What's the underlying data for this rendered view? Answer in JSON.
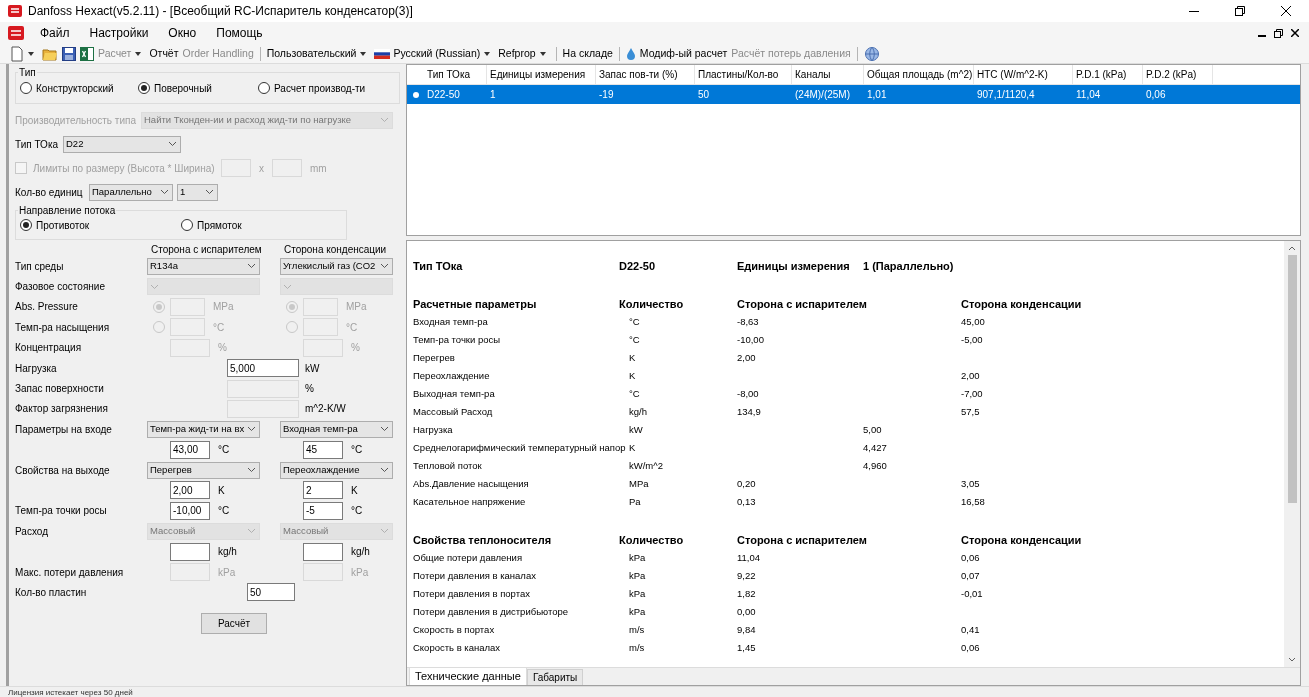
{
  "window": {
    "title": "Danfoss Hexact(v5.2.11) - [Всеобщий RC-Испаритель конденсатор(3)]"
  },
  "menu": [
    "Файл",
    "Настройки",
    "Окно",
    "Помощь"
  ],
  "toolbar": [
    {
      "kind": "icon",
      "dropdown": true
    },
    {
      "kind": "icon",
      "dropdown": false
    },
    {
      "kind": "icon",
      "dropdown": false
    },
    {
      "kind": "icon",
      "dropdown": false
    },
    {
      "kind": "text",
      "label": "Расчет",
      "disabled": true,
      "dropdown": true
    },
    {
      "kind": "text",
      "label": "Отчёт",
      "disabled": false,
      "dropdown": false
    },
    {
      "kind": "text",
      "label": "Order Handling",
      "disabled": true,
      "dropdown": false
    },
    {
      "kind": "separator"
    },
    {
      "kind": "text",
      "label": "Пользовательский",
      "disabled": false,
      "dropdown": true
    },
    {
      "kind": "language",
      "label": "Русский (Russian)",
      "disabled": false,
      "dropdown": true
    },
    {
      "kind": "text",
      "label": "Refprop",
      "disabled": false,
      "dropdown": true
    },
    {
      "kind": "separator"
    },
    {
      "kind": "text",
      "label": "На складе",
      "disabled": false,
      "dropdown": false
    },
    {
      "kind": "separator"
    },
    {
      "kind": "icon",
      "dropdown": false
    },
    {
      "kind": "text",
      "label": "Модиф-ый расчет",
      "disabled": false,
      "dropdown": false
    },
    {
      "kind": "text",
      "label": "Расчёт потерь давления",
      "disabled": true,
      "dropdown": false
    },
    {
      "kind": "separator"
    },
    {
      "kind": "icon",
      "dropdown": false
    }
  ],
  "left": {
    "type_group": {
      "legend": "Тип",
      "options": [
        {
          "label": "Конструкторский",
          "selected": false
        },
        {
          "label": "Поверочный",
          "selected": true
        },
        {
          "label": "Расчет производ-ти",
          "selected": false
        }
      ]
    },
    "performance": {
      "label": "Производительность типа",
      "value": "Найти  Тконден-ии и расход жид-ти по нагрузке",
      "disabled": true
    },
    "hex_type": {
      "label": "Тип ТОка",
      "value": "D22"
    },
    "size_limit": {
      "label": "Лимиты по размеру (Высота * Ширина)",
      "checked": false,
      "separator": "x",
      "unit": "mm"
    },
    "units": {
      "label": "Кол-во единиц",
      "mode": "Параллельно",
      "count": "1"
    },
    "flow": {
      "legend": "Направление потока",
      "options": [
        {
          "label": "Противоток",
          "selected": true
        },
        {
          "label": "Прямоток",
          "selected": false
        }
      ]
    },
    "sides": [
      "Сторона с испарителем",
      "Сторона конденсации"
    ],
    "rows": [
      {
        "kind": "selects",
        "label": "Тип среды",
        "left": {
          "value": "R134a",
          "disabled": false
        },
        "right": {
          "value": "Углекислый газ (CO2",
          "disabled": false
        }
      },
      {
        "kind": "selects",
        "label": "Фазовое состояние",
        "left": {
          "disabled": true
        },
        "right": {
          "disabled": true
        }
      },
      {
        "kind": "radio_input",
        "label": "Abs. Pressure",
        "left": {
          "selected": true,
          "unit": "MPa"
        },
        "right": {
          "selected": true,
          "unit": "MPa"
        }
      },
      {
        "kind": "radio_input",
        "label": "Темп-ра насыщения",
        "left": {
          "selected": false,
          "unit": "°C"
        },
        "right": {
          "selected": false,
          "unit": "°C"
        }
      },
      {
        "kind": "inputs",
        "label": "Концентрация",
        "left": {
          "disabled": true,
          "unit": "%"
        },
        "right": {
          "disabled": true,
          "unit": "%"
        }
      },
      {
        "kind": "single",
        "label": "Нагрузка",
        "value": "5,000",
        "disabled": false,
        "unit": "kW"
      },
      {
        "kind": "single",
        "label": "Запас поверхности",
        "disabled": true,
        "unit": "%"
      },
      {
        "kind": "single",
        "label": "Фактор загрязнения",
        "disabled": true,
        "unit": "m^2-K/W"
      },
      {
        "kind": "selects",
        "label": "Параметры на входе",
        "left": {
          "value": "Темп-ра жид-ти на вх",
          "disabled": false
        },
        "right": {
          "value": "Входная темп-ра",
          "disabled": false
        }
      },
      {
        "kind": "inputs",
        "left": {
          "value": "43,00",
          "disabled": false,
          "unit": "°C"
        },
        "right": {
          "value": "45",
          "disabled": false,
          "unit": "°C"
        }
      },
      {
        "kind": "selects",
        "label": "Свойства на выходе",
        "left": {
          "value": "Перегрев",
          "disabled": false
        },
        "right": {
          "value": "Переохлаждение",
          "disabled": false
        }
      },
      {
        "kind": "inputs",
        "left": {
          "value": "2,00",
          "disabled": false,
          "unit": "K"
        },
        "right": {
          "value": "2",
          "disabled": false,
          "unit": "K"
        }
      },
      {
        "kind": "inputs",
        "label": "Темп-ра точки росы",
        "left": {
          "value": "-10,00",
          "disabled": false,
          "unit": "°C"
        },
        "right": {
          "value": "-5",
          "disabled": false,
          "unit": "°C"
        }
      },
      {
        "kind": "selects",
        "label": "Расход",
        "left": {
          "value": "Массовый",
          "disabled": true
        },
        "right": {
          "value": "Массовый",
          "disabled": true
        }
      },
      {
        "kind": "inputs",
        "left": {
          "disabled": false,
          "unit": "kg/h"
        },
        "right": {
          "disabled": false,
          "unit": "kg/h"
        }
      },
      {
        "kind": "inputs",
        "label": "Макс. потери давления",
        "left": {
          "disabled": true,
          "unit": "kPa"
        },
        "right": {
          "disabled": true,
          "unit": "kPa"
        }
      },
      {
        "kind": "plates",
        "label": "Кол-во пластин",
        "value": "50",
        "disabled": false
      }
    ],
    "button": "Расчёт"
  },
  "table": {
    "columns": [
      "Тип ТОка",
      "Единицы измерения",
      "Запас пов-ти  (%)",
      "Пластины/Кол-во",
      "Каналы",
      "Общая площадь (m^2)",
      "HTC (W/m^2-K)",
      "P.D.1 (kPa)",
      "P.D.2 (kPa)"
    ],
    "rows": [
      {
        "selected": true,
        "cells": [
          "D22-50",
          "1",
          "-19",
          "50",
          "(24M)/(25M)",
          "1,01",
          "907,1/1120,4",
          "11,04",
          "0,06"
        ]
      }
    ]
  },
  "results": {
    "summary": [
      "Тип ТОка",
      "D22-50",
      "Единицы измерения",
      "1 (Параллельно)"
    ],
    "sections": [
      {
        "headers": [
          "Расчетные параметры",
          "Количество",
          "Сторона с испарителем",
          "Сторона конденсации"
        ],
        "rows": [
          {
            "name": "Входная темп-ра",
            "unit": "°C",
            "evaporator": "-8,63",
            "condenser": "45,00"
          },
          {
            "name": "Темп-ра точки росы",
            "unit": "°C",
            "evaporator": "-10,00",
            "condenser": "-5,00"
          },
          {
            "name": "Перегрев",
            "unit": "K",
            "evaporator": "2,00"
          },
          {
            "name": "Переохлаждение",
            "unit": "K",
            "condenser": "2,00"
          },
          {
            "name": "Выходная темп-ра",
            "unit": "°C",
            "evaporator": "-8,00",
            "condenser": "-7,00"
          },
          {
            "name": "Массовый Расход",
            "unit": "kg/h",
            "evaporator": "134,9",
            "condenser": "57,5"
          },
          {
            "name": "Нагрузка",
            "unit": "kW",
            "total": "5,00"
          },
          {
            "name": "Среднелогарифмический температурный напор",
            "unit": "K",
            "total": "4,427"
          },
          {
            "name": "Тепловой поток",
            "unit": "kW/m^2",
            "total": "4,960"
          },
          {
            "name": "Abs.Давление насыщения",
            "unit": "MPa",
            "evaporator": "0,20",
            "condenser": "3,05"
          },
          {
            "name": "Касательное напряжение",
            "unit": "Pa",
            "evaporator": "0,13",
            "condenser": "16,58"
          }
        ]
      },
      {
        "headers": [
          "Свойства теплоносителя",
          "Количество",
          "Сторона с испарителем",
          "Сторона конденсации"
        ],
        "rows": [
          {
            "name": "Общие потери давления",
            "unit": "kPa",
            "evaporator": "11,04",
            "condenser": "0,06"
          },
          {
            "name": "Потери давления в каналах",
            "unit": "kPa",
            "evaporator": "9,22",
            "condenser": "0,07"
          },
          {
            "name": "Потери давления в портах",
            "unit": "kPa",
            "evaporator": "1,82",
            "condenser": "-0,01"
          },
          {
            "name": "Потери давления в дистрибьюторе",
            "unit": "kPa",
            "evaporator": "0,00"
          },
          {
            "name": "Скорость в портах",
            "unit": "m/s",
            "evaporator": "9,84",
            "condenser": "0,41"
          },
          {
            "name": "Скорость в каналах",
            "unit": "m/s",
            "evaporator": "1,45",
            "condenser": "0,06"
          }
        ]
      }
    ]
  },
  "tabs": [
    {
      "label": "Технические данные",
      "selected": true
    },
    {
      "label": "Габариты",
      "selected": false
    }
  ],
  "status_bar": "Лицензия истекает через 50 дней"
}
